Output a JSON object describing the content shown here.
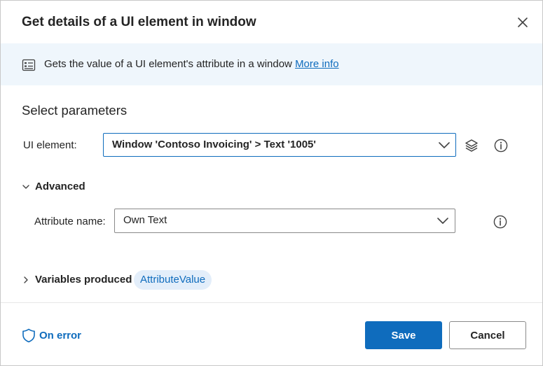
{
  "dialog": {
    "title": "Get details of a UI element in window",
    "close_icon": "close-icon"
  },
  "banner": {
    "icon": "details-list-icon",
    "text": "Gets the value of a UI element's attribute in a window",
    "link": "More info"
  },
  "parameters": {
    "section_title": "Select parameters",
    "ui_element": {
      "label": "UI element:",
      "value": "Window 'Contoso Invoicing' > Text '1005'",
      "layers_icon": "layers-icon",
      "info_icon": "info-icon"
    },
    "advanced": {
      "label": "Advanced",
      "expanded": true,
      "attribute_name": {
        "label": "Attribute name:",
        "value": "Own Text",
        "info_icon": "info-icon"
      }
    }
  },
  "variables": {
    "label": "Variables produced",
    "expanded": false,
    "items": [
      "AttributeValue"
    ]
  },
  "footer": {
    "on_error": "On error",
    "save": "Save",
    "cancel": "Cancel"
  },
  "colors": {
    "accent": "#0f6cbd",
    "banner_bg": "#eff6fc",
    "chip_bg": "#e3eefa"
  }
}
